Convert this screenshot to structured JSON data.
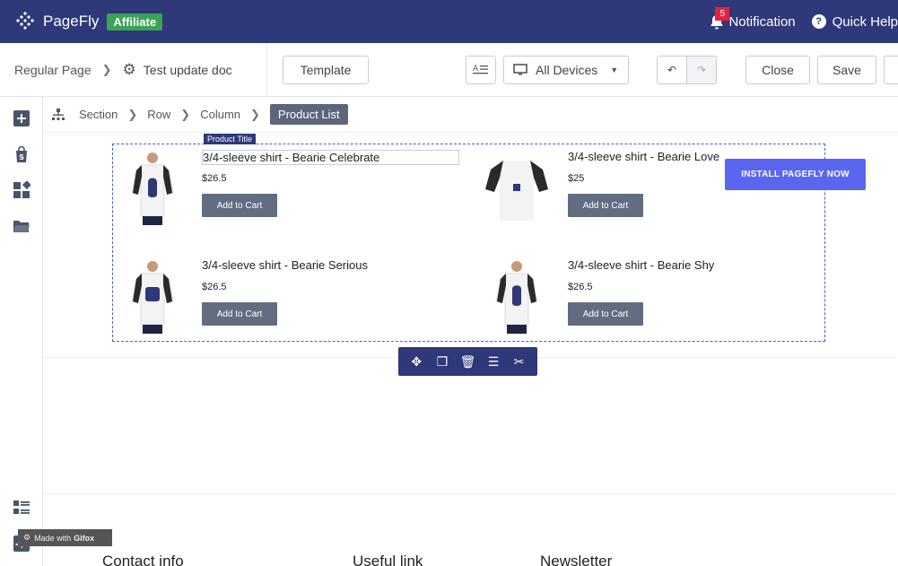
{
  "app": {
    "name": "PageFly",
    "badge": "Affiliate"
  },
  "topbar": {
    "notification_count": "5",
    "notification_label": "Notification",
    "help_label": "Quick Help"
  },
  "toolbar": {
    "page_type": "Regular Page",
    "page_name": "Test update doc",
    "template_label": "Template",
    "device_label": "All Devices",
    "close_label": "Close",
    "save_label": "Save"
  },
  "breadcrumb2": {
    "section": "Section",
    "row": "Row",
    "column": "Column",
    "active": "Product List"
  },
  "editor": {
    "selected_tag": "Product Title",
    "install_cta": "INSTALL PAGEFLY NOW"
  },
  "products": [
    {
      "title": "3/4-sleeve shirt - Bearie Celebrate",
      "price": "$26.5",
      "button": "Add to Cart"
    },
    {
      "title": "3/4-sleeve shirt - Bearie Love",
      "price": "$25",
      "button": "Add to Cart"
    },
    {
      "title": "3/4-sleeve shirt - Bearie Serious",
      "price": "$26.5",
      "button": "Add to Cart"
    },
    {
      "title": "3/4-sleeve shirt - Bearie Shy",
      "price": "$26.5",
      "button": "Add to Cart"
    }
  ],
  "footer": {
    "col1": "Contact info",
    "col2": "Useful link",
    "col3": "Newsletter"
  },
  "watermark": {
    "prefix": "Made with",
    "brand": "Gifox"
  },
  "colors": {
    "topbar": "#2f3878",
    "affiliate": "#3aa356",
    "selection": "#4a5bd6",
    "cta": "#5b66f0",
    "button": "#626d82"
  }
}
